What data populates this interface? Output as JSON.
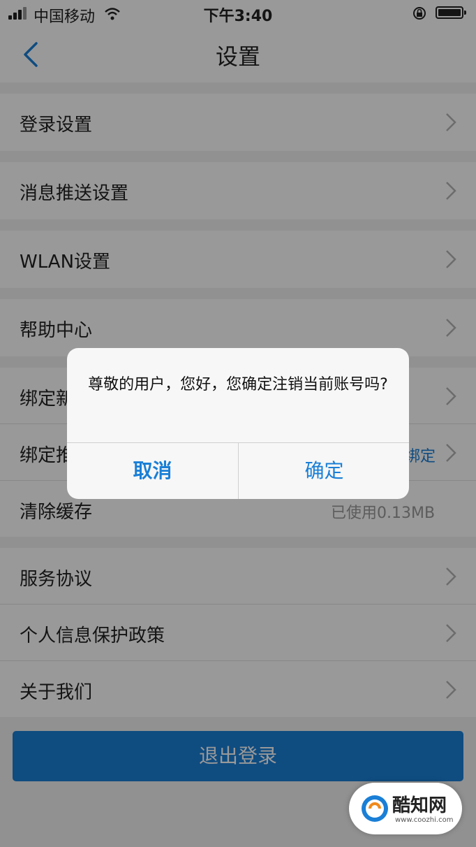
{
  "status_bar": {
    "carrier": "中国移动",
    "time": "下午3:40",
    "icons": [
      "signal-icon",
      "wifi-icon",
      "rotation-lock-icon",
      "battery-icon"
    ]
  },
  "nav": {
    "title": "设置",
    "back_icon": "chevron-left-icon"
  },
  "settings": {
    "login": "登录设置",
    "push": "消息推送设置",
    "wlan": "WLAN设置",
    "help": "帮助中心",
    "bind_new": "绑定新",
    "bind_partial": "绑定推",
    "bind_value": "绑定",
    "clear_cache": "清除缓存",
    "cache_used": "已使用0.13MB",
    "service": "服务协议",
    "privacy": "个人信息保护政策",
    "about": "关于我们"
  },
  "logout_button": "退出登录",
  "dialog": {
    "message": "尊敬的用户，您好，您确定注销当前账号吗?",
    "cancel": "取消",
    "confirm": "确定"
  },
  "watermark": {
    "brand": "酷知网",
    "url": "www.coozhi.com"
  },
  "colors": {
    "accent": "#1a7fd6",
    "background": "#f2f2f2",
    "overlay": "rgba(0,0,0,0.40)"
  }
}
